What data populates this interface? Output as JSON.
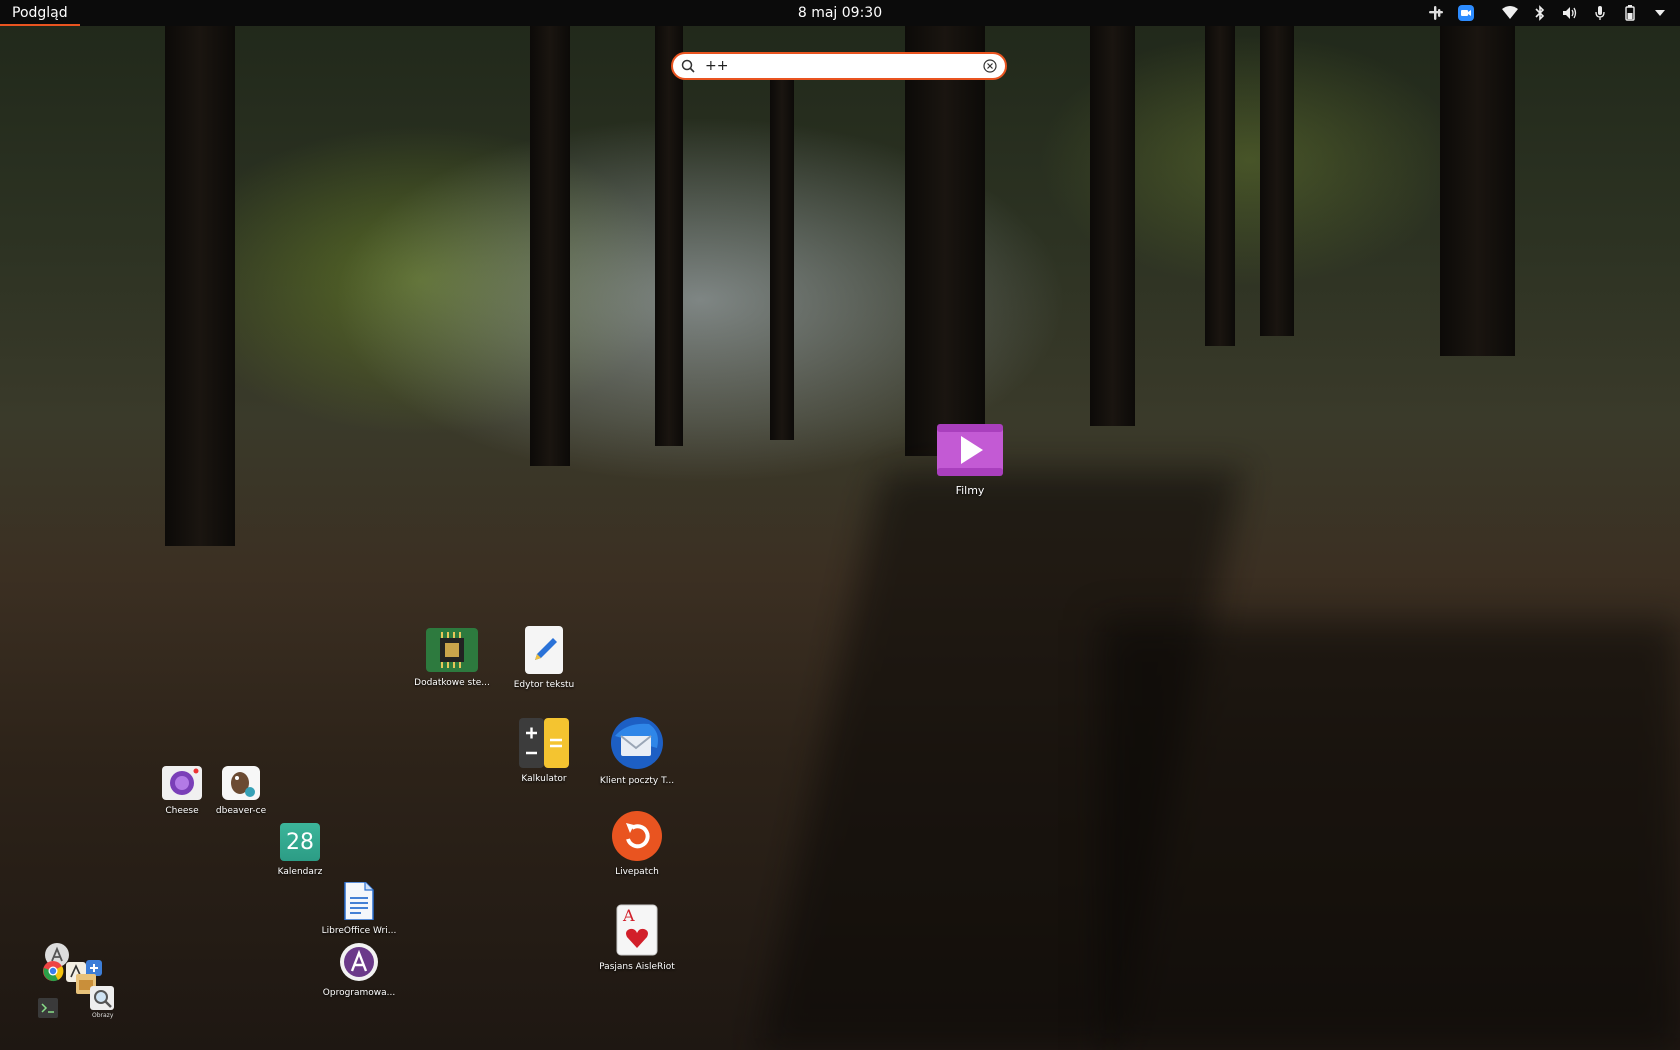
{
  "topbar": {
    "activities_label": "Podgląd",
    "clock": "8 maj  09:30",
    "tray_icons": [
      "slack-icon",
      "zoom-icon",
      "wifi-icon",
      "bluetooth-icon",
      "volume-icon",
      "microphone-icon",
      "battery-icon",
      "system-menu-arrow-icon"
    ]
  },
  "search": {
    "value": "++",
    "placeholder": ""
  },
  "apps": {
    "filmy": "Filmy",
    "dodatkowe": "Dodatkowe ste...",
    "edytor": "Edytor tekstu",
    "kalkulator": "Kalkulator",
    "klient": "Klient poczty T...",
    "livepatch": "Livepatch",
    "pasjans": "Pasjans AisleRiot",
    "cheese": "Cheese",
    "dbeaver": "dbeaver-ce",
    "kalendarz": "Kalendarz",
    "kalendarz_day": "28",
    "libreoffice": "LibreOffice Wri...",
    "oprogramowanie": "Oprogramowa...",
    "obrazy": "Obrazy"
  },
  "colors": {
    "accent": "#e95420",
    "topbar_bg": "#0b0b0b"
  }
}
